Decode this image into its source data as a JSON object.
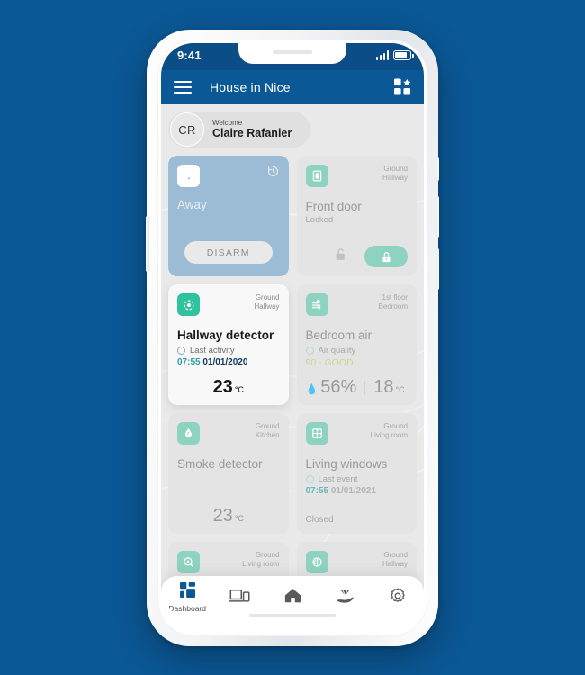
{
  "background_color": "#0b5896",
  "status_bar": {
    "time": "9:41",
    "signal_icon": "signal-bars-icon",
    "battery_icon": "battery-icon"
  },
  "app_bar": {
    "menu_icon": "hamburger-menu-icon",
    "title": "House in Nice",
    "widgets_icon": "add-widget-grid-icon"
  },
  "welcome": {
    "avatar_initials": "CR",
    "label": "Welcome",
    "name": "Claire Rafanier"
  },
  "cards": {
    "alarm": {
      "icon": "lock-shield-icon",
      "history_icon": "history-clock-icon",
      "title": "Away",
      "button_label": "DISARM",
      "background": "#9cbbd4"
    },
    "front_door": {
      "icon": "door-icon",
      "location_floor": "Ground",
      "location_room": "Hallway",
      "title": "Front door",
      "status": "Locked",
      "unlock_icon": "unlock-icon",
      "lock_icon": "lock-icon"
    },
    "hallway_detector": {
      "icon": "motion-detector-icon",
      "location_floor": "Ground",
      "location_room": "Hallway",
      "title": "Hallway detector",
      "status_label": "Last activity",
      "time": "07:55",
      "date": "01/01/2020",
      "temperature": "23",
      "temperature_unit": "°C",
      "accent": "#2ec29e"
    },
    "bedroom_air": {
      "icon": "air-flow-icon",
      "location_floor": "1st floor",
      "location_room": "Bedroom",
      "title": "Bedroom air",
      "status_label": "Air quality",
      "quality": "90 - GOOD",
      "quality_color": "#cdd68a",
      "humidity_icon": "humidity-drop-icon",
      "humidity": "56%",
      "temperature": "18",
      "temperature_unit": "°C"
    },
    "smoke_detector": {
      "icon": "flame-icon",
      "location_floor": "Ground",
      "location_room": "Kitchen",
      "title": "Smoke detector",
      "temperature": "23",
      "temperature_unit": "°C"
    },
    "living_windows": {
      "icon": "window-grid-icon",
      "location_floor": "Ground",
      "location_room": "Living room",
      "title": "Living windows",
      "status_label": "Last event",
      "time": "07:55",
      "date": "01/01/2021",
      "state": "Closed"
    },
    "partial_left": {
      "icon": "camera-icon",
      "location_floor": "Ground",
      "location_room": "Living room"
    },
    "partial_right": {
      "icon": "siren-icon",
      "location_floor": "Ground",
      "location_room": "Hallway"
    }
  },
  "bottom_nav": [
    {
      "icon": "dashboard-grid-icon",
      "label": "Dashboard",
      "active": true
    },
    {
      "icon": "devices-icon",
      "label": "",
      "active": false
    },
    {
      "icon": "home-icon",
      "label": "",
      "active": false
    },
    {
      "icon": "services-hand-icon",
      "label": "",
      "active": false
    },
    {
      "icon": "settings-gear-icon",
      "label": "",
      "active": false
    }
  ]
}
